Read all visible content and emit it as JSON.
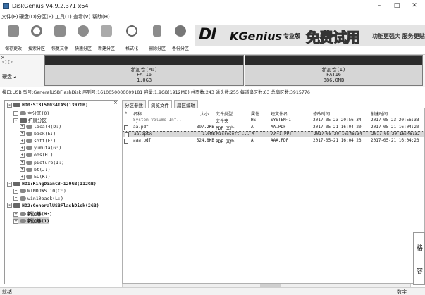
{
  "window": {
    "title": "DiskGenius V4.9.2.371 x64",
    "controls": [
      "–",
      "□",
      "✕"
    ]
  },
  "menu": [
    "文件(F)",
    "硬盘(D)",
    "分区(P)",
    "工具(T)",
    "查看(V)",
    "帮助(H)"
  ],
  "toolbar": {
    "buttons": [
      "保存更改",
      "搜索分区",
      "恢复文件",
      "快速分区",
      "新建分区",
      "格式化",
      "删除分区",
      "备份分区"
    ],
    "banner": {
      "logo": "DI",
      "logo2": "KGenius",
      "edition": "专业版",
      "free": "免费试用",
      "slogan": "功能更强大 服务更贴心"
    }
  },
  "diskbar": {
    "close": "×",
    "nav": "◁ ▷",
    "disk_label": "硬盘 2",
    "partitions": [
      {
        "name": "新加卷(M:)",
        "fs": "FAT16",
        "size": "1.0GB"
      },
      {
        "name": "新加卷(I)",
        "fs": "FAT16",
        "size": "886.0MB"
      }
    ]
  },
  "info_line": "接口:USB  型号:GeneralUSBFlashDisk  序列号:1610050000009181  容量:1.9GB(1912MB)  柱面数:243  磁头数:255  每道扇区数:63  总扇区数:3915776",
  "tree": {
    "close": "×",
    "items": [
      {
        "text": "HD0:ST3150034IAS(1397GB)",
        "exp": "-",
        "icon": "disk",
        "bold": true,
        "indent": 0
      },
      {
        "text": "主分区(0)",
        "exp": "+",
        "icon": "part",
        "bold": false,
        "indent": 1
      },
      {
        "text": "扩展分区",
        "exp": "-",
        "icon": "disk",
        "bold": false,
        "indent": 1
      },
      {
        "text": "local4(D:)",
        "exp": "+",
        "icon": "part",
        "bold": false,
        "indent": 2
      },
      {
        "text": "back(E:)",
        "exp": "+",
        "icon": "part",
        "bold": false,
        "indent": 2
      },
      {
        "text": "soft(F:)",
        "exp": "+",
        "icon": "part",
        "bold": false,
        "indent": 2
      },
      {
        "text": "yumufa(G:)",
        "exp": "+",
        "icon": "part",
        "bold": false,
        "indent": 2
      },
      {
        "text": "obs(H:)",
        "exp": "+",
        "icon": "part",
        "bold": false,
        "indent": 2
      },
      {
        "text": "picture(I:)",
        "exp": "+",
        "icon": "part",
        "bold": false,
        "indent": 2
      },
      {
        "text": "bt(J:)",
        "exp": "+",
        "icon": "part",
        "bold": false,
        "indent": 2
      },
      {
        "text": "EL(K:)",
        "exp": "+",
        "icon": "part",
        "bold": false,
        "indent": 2
      },
      {
        "text": "HD1:KingDianC3-120GB(112GB)",
        "exp": "-",
        "icon": "disk",
        "bold": true,
        "indent": 0
      },
      {
        "text": "WINDOWS 10(C:)",
        "exp": "+",
        "icon": "part",
        "bold": false,
        "indent": 1
      },
      {
        "text": "win10back(L:)",
        "exp": "+",
        "icon": "part",
        "bold": false,
        "indent": 1
      },
      {
        "text": "HD2:GeneralUSBFlashDisk(2GB)",
        "exp": "-",
        "icon": "disk",
        "bold": true,
        "indent": 0
      },
      {
        "text": "新加卷(M:)",
        "exp": "+",
        "icon": "part",
        "bold": true,
        "indent": 1
      },
      {
        "text": "新加卷(1)",
        "exp": "+",
        "icon": "part",
        "bold": true,
        "indent": 1,
        "selected": true
      }
    ]
  },
  "tabs": [
    "分区参数",
    "浏览文件",
    "扇区编辑"
  ],
  "file_list": {
    "headers": [
      "名称",
      "大小",
      "文件类型",
      "属性",
      "短文件名",
      "修改时间",
      "创建时间"
    ],
    "rows": [
      [
        "System Volume Inf...",
        "",
        "文件夹",
        "HS",
        "SYSTEM~1",
        "2017-05-23 20:56:34",
        "2017-05-23 20:56:33"
      ],
      [
        "aa.pdf",
        "897.2KB",
        "PDF 文件",
        "A",
        "AA.PDF",
        "2017-05-21 16:04:20",
        "2017-05-21 16:04:20"
      ],
      [
        "aa.pptx",
        "1.0MB",
        "Microsoft ...",
        "A",
        "AA~1.PPT",
        "2017-05-20 16:46:34",
        "2017-05-20 16:46:32"
      ],
      [
        "aaa.pdf",
        "524.8KB",
        "PDF 文件",
        "A",
        "AAA.PDF",
        "2017-05-21 16:04:23",
        "2017-05-21 16:04:23"
      ]
    ]
  },
  "side_popup": [
    "格",
    "容"
  ],
  "status": {
    "left": "就绪",
    "right": "数字"
  }
}
